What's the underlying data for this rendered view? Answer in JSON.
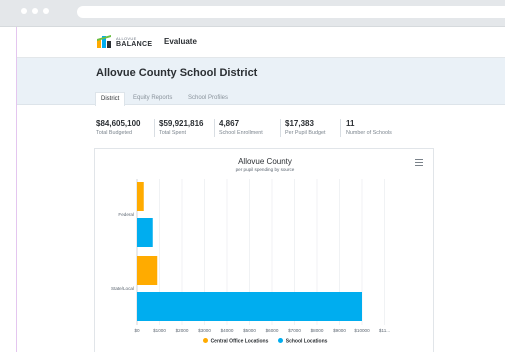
{
  "brand": {
    "small": "ALLOVUE",
    "name": "BALANCE",
    "app_title": "Evaluate"
  },
  "page": {
    "title": "Allovue County School District"
  },
  "tabs": [
    {
      "label": "District",
      "active": true
    },
    {
      "label": "Equity Reports",
      "active": false
    },
    {
      "label": "School Profiles",
      "active": false
    }
  ],
  "stats": [
    {
      "value": "$84,605,100",
      "label": "Total Budgeted"
    },
    {
      "value": "$59,921,816",
      "label": "Total Spent"
    },
    {
      "value": "4,867",
      "label": "School Enrollment"
    },
    {
      "value": "$17,383",
      "label": "Per Pupil Budget"
    },
    {
      "value": "11",
      "label": "Number of Schools"
    }
  ],
  "chart": {
    "menu_icon": "hamburger-menu-icon"
  },
  "colors": {
    "orange": "#ffab00",
    "blue": "#00adef",
    "accent_border": "#e4c6ef"
  },
  "chart_data": {
    "type": "bar",
    "orientation": "horizontal",
    "title": "Allovue County",
    "subtitle": "per pupil spending by source",
    "categories": [
      "Federal",
      "State/Local"
    ],
    "series": [
      {
        "name": "Central Office Locations",
        "color": "#ffab00",
        "values": [
          300,
          900
        ]
      },
      {
        "name": "School Locations",
        "color": "#00adef",
        "values": [
          700,
          10000
        ]
      }
    ],
    "x_ticks": [
      "$0",
      "$1000",
      "$2000",
      "$3000",
      "$4000",
      "$5000",
      "$6000",
      "$7000",
      "$8000",
      "$9000",
      "$10000",
      "$11..."
    ],
    "xlim": [
      0,
      11000
    ],
    "grid": true,
    "legend": "bottom"
  }
}
